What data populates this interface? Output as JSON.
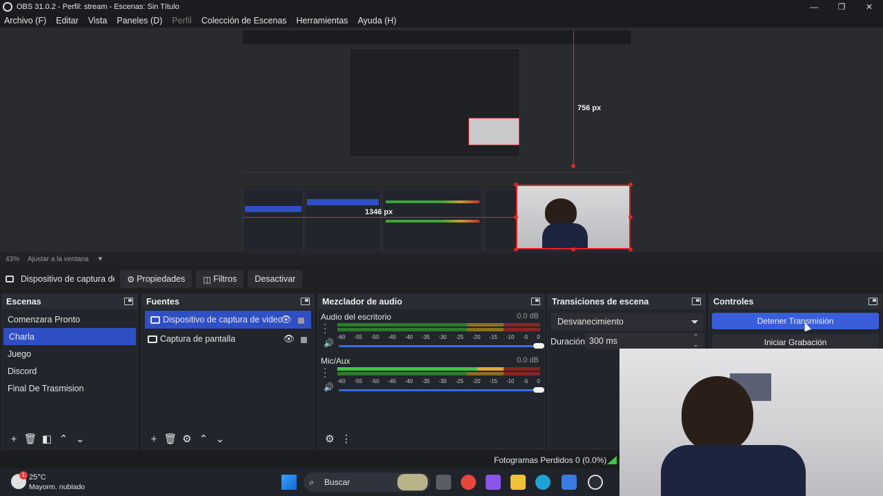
{
  "window": {
    "title": "OBS 31.0.2 - Perfil: stream - Escenas: Sin Título"
  },
  "menu": [
    "Archivo (F)",
    "Editar",
    "Vista",
    "Paneles (D)",
    "Perfil",
    "Colección de Escenas",
    "Herramientas",
    "Ayuda (H)"
  ],
  "preview": {
    "label_height": "756 px",
    "label_width": "1346 px",
    "zoom": "43%",
    "zoom_mode": "Ajustar a la ventana"
  },
  "source_toolbar": {
    "source_name": "Dispositivo de captura de v",
    "properties": "Propiedades",
    "filters": "Filtros",
    "deactivate": "Desactivar"
  },
  "scenes": {
    "title": "Escenas",
    "items": [
      "Comenzara Pronto",
      "Charla",
      "Juego",
      "Discord",
      "Final De Trasmision"
    ],
    "selected": 1
  },
  "sources": {
    "title": "Fuentes",
    "items": [
      "Dispositivo de captura de video",
      "Captura de pantalla"
    ]
  },
  "mixer": {
    "title": "Mezclador de audio",
    "channels": [
      {
        "name": "Audio del escritorio",
        "db": "0.0 dB"
      },
      {
        "name": "Mic/Aux",
        "db": "0.0 dB"
      }
    ],
    "scale": [
      "-60",
      "-55",
      "-50",
      "-45",
      "-40",
      "-35",
      "-30",
      "-25",
      "-20",
      "-15",
      "-10",
      "-5",
      "0"
    ]
  },
  "transitions": {
    "title": "Transiciones de escena",
    "selected": "Desvanecimiento",
    "duration_label": "Duración",
    "duration_value": "300 ms"
  },
  "controls": {
    "title": "Controles",
    "stop_stream": "Detener Transmisión",
    "start_record": "Iniciar Grabación"
  },
  "status": {
    "dropped_frames": "Fotogramas Perdidos 0 (0.0%)"
  },
  "taskbar": {
    "weather_temp": "25°C",
    "weather_desc": "Mayorm. nublado",
    "weather_badge": "1",
    "search": "Buscar"
  },
  "colors": {
    "accent": "#2f4fc4",
    "button_primary": "#3a5ed9",
    "record_red": "#e0262a"
  }
}
